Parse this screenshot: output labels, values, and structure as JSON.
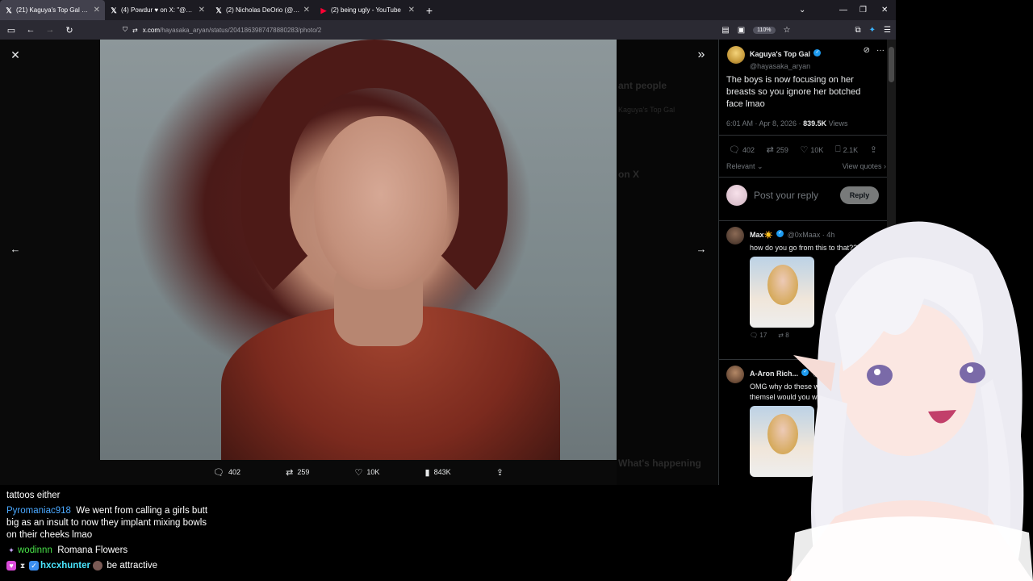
{
  "browser": {
    "tabs": [
      {
        "favicon": "x-logo-icon",
        "title": "(21) Kaguya's Top Gal on X: \"Th",
        "active": true
      },
      {
        "favicon": "x-logo-icon",
        "title": "(4) Powdur ♥ on X: \"@nich",
        "active": false
      },
      {
        "favicon": "x-logo-icon",
        "title": "(2) Nicholas DeOrio (@nichola",
        "active": false
      },
      {
        "favicon": "youtube-icon",
        "title": "(2) being ugly - YouTube",
        "active": false
      }
    ],
    "new_tab": "+",
    "url_host": "x.com",
    "url_path": "/hayasaka_aryan/status/2041863987478880283/photo/2",
    "zoom": "110%"
  },
  "viewer": {
    "close": "✕",
    "next_pane": "»",
    "prev": "←",
    "next": "→",
    "actions": {
      "replies": "402",
      "reposts": "259",
      "likes": "10K",
      "views": "843K"
    },
    "background_hints": [
      "ant people",
      "Kaguya's Top Gal",
      "on X",
      "What's happening"
    ]
  },
  "post": {
    "author_name": "Kaguya's Top Gal",
    "author_handle": "@hayasaka_aryan",
    "text": "The boys is now focusing on her breasts so you ignore her botched face lmao",
    "time": "6:01 AM · Apr 8, 2026 · ",
    "views_count": "839.5K",
    "views_label": " Views",
    "stats": {
      "replies": "402",
      "reposts": "259",
      "likes": "10K",
      "bookmarks": "2.1K"
    },
    "sort_label": "Relevant",
    "view_quotes": "View quotes",
    "reply_placeholder": "Post your reply",
    "reply_button": "Reply"
  },
  "replies": [
    {
      "name": "Max☀️",
      "handle": "@0xMaax · 4h",
      "text": "how do you go from this to that??",
      "stats": {
        "replies": "17",
        "reposts": "8"
      }
    },
    {
      "name": "A-Aron Rich...",
      "handle": "@a",
      "text": "OMG why do these w doing this to themsel would you want to cha",
      "stats": {}
    }
  ],
  "chat": {
    "line0": "tattoos either",
    "msg1_user": "Pyromaniac918",
    "msg1_text": "We went from calling a girls butt big as an insult to now they implant mixing bowls on their cheeks lmao",
    "msg2_user": "wodinnn",
    "msg2_text": "Romana Flowers",
    "msg3_user": "hxcxhunter",
    "msg3_text": "be attractive"
  },
  "colors": {
    "accent": "#1d9bf0",
    "bg": "#000000",
    "chrome": "#2b2a33"
  }
}
